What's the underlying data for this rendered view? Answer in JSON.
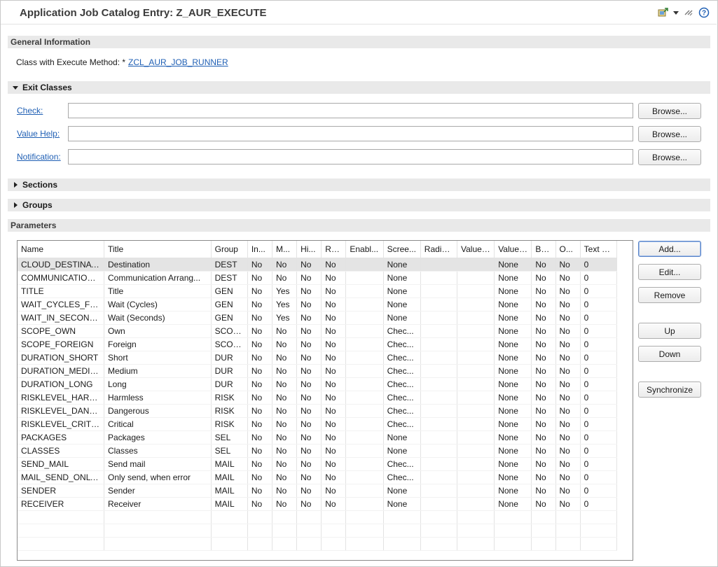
{
  "header": {
    "title": "Application Job Catalog Entry: Z_AUR_EXECUTE",
    "icons": [
      "export-icon",
      "dropdown-arrow-icon",
      "link-icon",
      "help-icon"
    ]
  },
  "general_info": {
    "section_title": "General Information",
    "class_label": "Class with Execute Method: *",
    "class_value": "ZCL_AUR_JOB_RUNNER"
  },
  "exit_classes": {
    "section_title": "Exit Classes",
    "expanded": true,
    "rows": [
      {
        "label": "Check:",
        "value": "",
        "button": "Browse..."
      },
      {
        "label": "Value Help:",
        "value": "",
        "button": "Browse..."
      },
      {
        "label": "Notification:",
        "value": "",
        "button": "Browse..."
      }
    ]
  },
  "sections": {
    "section_title": "Sections",
    "expanded": false
  },
  "groups": {
    "section_title": "Groups",
    "expanded": false
  },
  "parameters": {
    "section_title": "Parameters",
    "columns": [
      "Name",
      "Title",
      "Group",
      "In...",
      "M...",
      "Hi...",
      "Re...",
      "Enabl...",
      "Scree...",
      "Radio...",
      "Value ...",
      "Value ...",
      "Ba...",
      "O...",
      "Text L..."
    ],
    "rows": [
      [
        "CLOUD_DESTINATI...",
        "Destination",
        "DEST",
        "No",
        "No",
        "No",
        "No",
        "",
        "None",
        "",
        "",
        "None",
        "No",
        "No",
        "0"
      ],
      [
        "COMMUNICATION...",
        "Communication Arrang...",
        "DEST",
        "No",
        "No",
        "No",
        "No",
        "",
        "None",
        "",
        "",
        "None",
        "No",
        "No",
        "0"
      ],
      [
        "TITLE",
        "Title",
        "GEN",
        "No",
        "Yes",
        "No",
        "No",
        "",
        "None",
        "",
        "",
        "None",
        "No",
        "No",
        "0"
      ],
      [
        "WAIT_CYCLES_FOR...",
        "Wait (Cycles)",
        "GEN",
        "No",
        "Yes",
        "No",
        "No",
        "",
        "None",
        "",
        "",
        "None",
        "No",
        "No",
        "0"
      ],
      [
        "WAIT_IN_SECONDS",
        "Wait (Seconds)",
        "GEN",
        "No",
        "Yes",
        "No",
        "No",
        "",
        "None",
        "",
        "",
        "None",
        "No",
        "No",
        "0"
      ],
      [
        "SCOPE_OWN",
        "Own",
        "SCOPE",
        "No",
        "No",
        "No",
        "No",
        "",
        "Chec...",
        "",
        "",
        "None",
        "No",
        "No",
        "0"
      ],
      [
        "SCOPE_FOREIGN",
        "Foreign",
        "SCOPE",
        "No",
        "No",
        "No",
        "No",
        "",
        "Chec...",
        "",
        "",
        "None",
        "No",
        "No",
        "0"
      ],
      [
        "DURATION_SHORT",
        "Short",
        "DUR",
        "No",
        "No",
        "No",
        "No",
        "",
        "Chec...",
        "",
        "",
        "None",
        "No",
        "No",
        "0"
      ],
      [
        "DURATION_MEDIUM",
        "Medium",
        "DUR",
        "No",
        "No",
        "No",
        "No",
        "",
        "Chec...",
        "",
        "",
        "None",
        "No",
        "No",
        "0"
      ],
      [
        "DURATION_LONG",
        "Long",
        "DUR",
        "No",
        "No",
        "No",
        "No",
        "",
        "Chec...",
        "",
        "",
        "None",
        "No",
        "No",
        "0"
      ],
      [
        "RISKLEVEL_HARML...",
        "Harmless",
        "RISK",
        "No",
        "No",
        "No",
        "No",
        "",
        "Chec...",
        "",
        "",
        "None",
        "No",
        "No",
        "0"
      ],
      [
        "RISKLEVEL_DANGE...",
        "Dangerous",
        "RISK",
        "No",
        "No",
        "No",
        "No",
        "",
        "Chec...",
        "",
        "",
        "None",
        "No",
        "No",
        "0"
      ],
      [
        "RISKLEVEL_CRITICAL",
        "Critical",
        "RISK",
        "No",
        "No",
        "No",
        "No",
        "",
        "Chec...",
        "",
        "",
        "None",
        "No",
        "No",
        "0"
      ],
      [
        "PACKAGES",
        "Packages",
        "SEL",
        "No",
        "No",
        "No",
        "No",
        "",
        "None",
        "",
        "",
        "None",
        "No",
        "No",
        "0"
      ],
      [
        "CLASSES",
        "Classes",
        "SEL",
        "No",
        "No",
        "No",
        "No",
        "",
        "None",
        "",
        "",
        "None",
        "No",
        "No",
        "0"
      ],
      [
        "SEND_MAIL",
        "Send mail",
        "MAIL",
        "No",
        "No",
        "No",
        "No",
        "",
        "Chec...",
        "",
        "",
        "None",
        "No",
        "No",
        "0"
      ],
      [
        "MAIL_SEND_ONLY_...",
        "Only send, when error",
        "MAIL",
        "No",
        "No",
        "No",
        "No",
        "",
        "Chec...",
        "",
        "",
        "None",
        "No",
        "No",
        "0"
      ],
      [
        "SENDER",
        "Sender",
        "MAIL",
        "No",
        "No",
        "No",
        "No",
        "",
        "None",
        "",
        "",
        "None",
        "No",
        "No",
        "0"
      ],
      [
        "RECEIVER",
        "Receiver",
        "MAIL",
        "No",
        "No",
        "No",
        "No",
        "",
        "None",
        "",
        "",
        "None",
        "No",
        "No",
        "0"
      ]
    ],
    "buttons": {
      "add": "Add...",
      "edit": "Edit...",
      "remove": "Remove",
      "up": "Up",
      "down": "Down",
      "synchronize": "Synchronize"
    }
  }
}
